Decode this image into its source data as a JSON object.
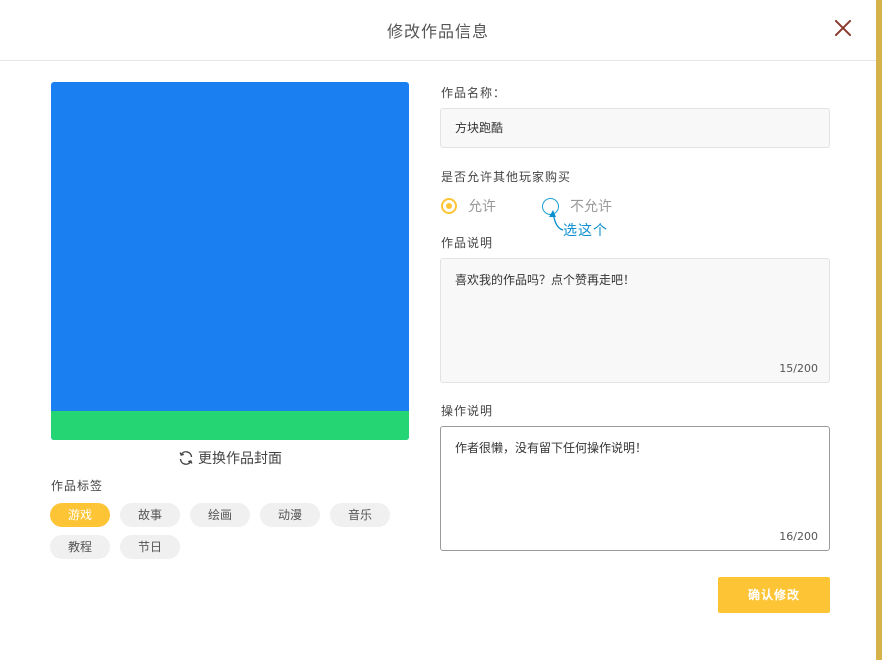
{
  "dialog": {
    "title": "修改作品信息",
    "change_cover_label": "更换作品封面"
  },
  "tags_section": {
    "label": "作品标签",
    "tags": [
      {
        "label": "游戏",
        "active": true
      },
      {
        "label": "故事",
        "active": false
      },
      {
        "label": "绘画",
        "active": false
      },
      {
        "label": "动漫",
        "active": false
      },
      {
        "label": "音乐",
        "active": false
      },
      {
        "label": "教程",
        "active": false
      },
      {
        "label": "节日",
        "active": false
      }
    ]
  },
  "form": {
    "name_label": "作品名称：",
    "name_value": "方块跑酷",
    "purchase_label": "是否允许其他玩家购买",
    "purchase_options": [
      "允许",
      "不允许"
    ],
    "purchase_selected": "允许",
    "annotation": "选这个",
    "desc_label": "作品说明",
    "desc_value": "喜欢我的作品吗？点个赞再走吧！",
    "desc_count": "15/200",
    "ops_label": "操作说明",
    "ops_value": "作者很懒，没有留下任何操作说明！",
    "ops_count": "16/200",
    "confirm_label": "确认修改"
  },
  "colors": {
    "accent": "#fdc536",
    "cover_sky": "#1a7ff0",
    "cover_ground": "#25d574",
    "annotation": "#0a8fd0"
  }
}
